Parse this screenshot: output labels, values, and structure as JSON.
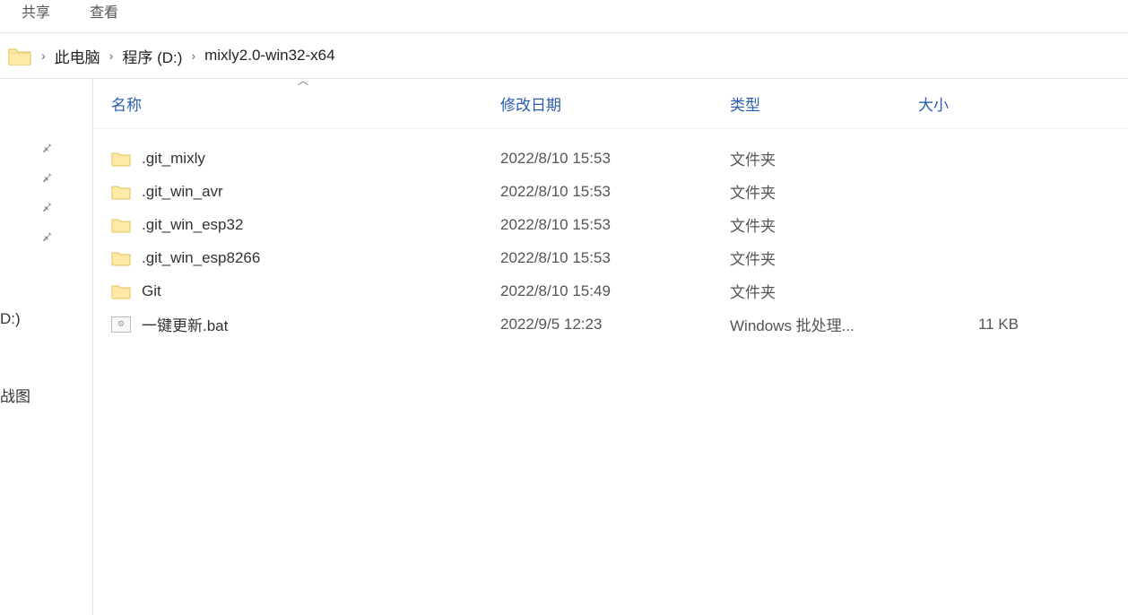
{
  "ribbon": {
    "share": "共享",
    "view": "查看"
  },
  "breadcrumb": {
    "pc": "此电脑",
    "drive": "程序 (D:)",
    "folder": "mixly2.0-win32-x64"
  },
  "columns": {
    "name": "名称",
    "date": "修改日期",
    "type": "类型",
    "size": "大小"
  },
  "sidebar": {
    "drive": "D:)",
    "view_label": "战图"
  },
  "files": [
    {
      "name": ".git_mixly",
      "date": "2022/8/10 15:53",
      "type": "文件夹",
      "size": "",
      "icon": "folder"
    },
    {
      "name": ".git_win_avr",
      "date": "2022/8/10 15:53",
      "type": "文件夹",
      "size": "",
      "icon": "folder"
    },
    {
      "name": ".git_win_esp32",
      "date": "2022/8/10 15:53",
      "type": "文件夹",
      "size": "",
      "icon": "folder"
    },
    {
      "name": ".git_win_esp8266",
      "date": "2022/8/10 15:53",
      "type": "文件夹",
      "size": "",
      "icon": "folder"
    },
    {
      "name": "Git",
      "date": "2022/8/10 15:49",
      "type": "文件夹",
      "size": "",
      "icon": "folder"
    },
    {
      "name": "一键更新.bat",
      "date": "2022/9/5 12:23",
      "type": "Windows 批处理...",
      "size": "11 KB",
      "icon": "bat"
    }
  ]
}
